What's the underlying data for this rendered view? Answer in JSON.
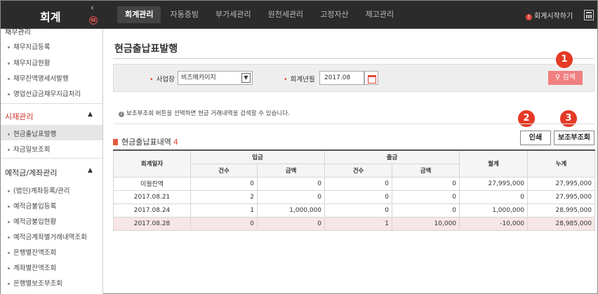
{
  "app": {
    "title": "회계"
  },
  "nav": {
    "tabs": [
      "회계관리",
      "자동증빙",
      "부가세관리",
      "원천세관리",
      "고정자산",
      "제고관리"
    ],
    "start_link": "회계시작하기"
  },
  "sidebar": {
    "cut_header": "채무관리",
    "group1_items": [
      "채무지급등록",
      "채무지급현황",
      "채무잔액명세서발행",
      "영업선급금채무지급처리"
    ],
    "group2_title": "시재관리",
    "group2_items": [
      "현금출납표발행",
      "자금일보조회"
    ],
    "group3_title": "예적금/계좌관리",
    "group3_items": [
      "(법인)계좌등록/관리",
      "예적금불입등록",
      "예적금불입현황",
      "예적금계좌별거래내역조회",
      "은행별잔액조회",
      "계좌별잔액조회",
      "은행별보조부조회"
    ]
  },
  "page": {
    "title": "현금출납표발행"
  },
  "search": {
    "biz_label": "사업장",
    "biz_value": "비즈메카이지",
    "month_label": "회계년월",
    "month_value": "2017.08",
    "search_label": "검색"
  },
  "badges": [
    "1",
    "2",
    "3"
  ],
  "notice": "보조부조회 버튼을 선택하면 현금 거래내역을 검색할 수 있습니다.",
  "actions": {
    "print_label": "인쇄",
    "ledger_label": "보조부조회"
  },
  "list": {
    "title": "현금출납표내역",
    "count": "4"
  },
  "table": {
    "h_date": "회계일자",
    "h_in": "입금",
    "h_out": "출금",
    "h_month": "월계",
    "h_cum": "누계",
    "h_count": "건수",
    "h_amount": "금액",
    "rows": [
      [
        "이월잔액",
        "0",
        "0",
        "0",
        "0",
        "27,995,000",
        "27,995,000"
      ],
      [
        "2017.08.21",
        "2",
        "0",
        "0",
        "0",
        "0",
        "27,995,000"
      ],
      [
        "2017.08.24",
        "1",
        "1,000,000",
        "0",
        "0",
        "1,000,000",
        "28,995,000"
      ],
      [
        "2017.08.28",
        "0",
        "0",
        "1",
        "10,000",
        "-10,000",
        "28,985,000"
      ]
    ]
  },
  "colors": {
    "topbar": "#2b2b2b",
    "accent": "#e0493a",
    "search_button": "#f08080",
    "badge": "#e53a25",
    "highlight_row": "#f7e6e6"
  }
}
